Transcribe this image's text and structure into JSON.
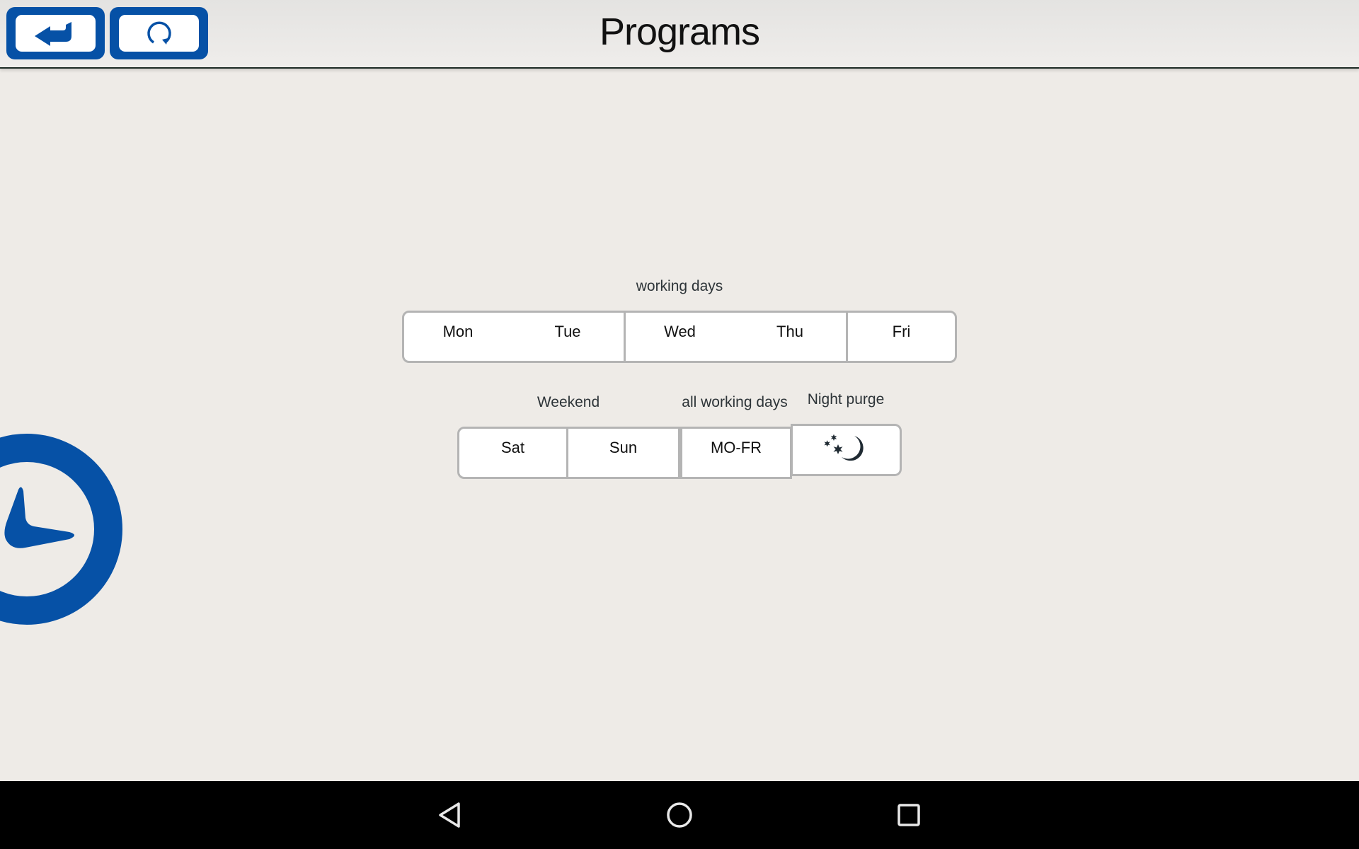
{
  "header": {
    "title": "Programs",
    "back_button": {
      "icon": "return-arrow-icon"
    },
    "refresh_button": {
      "icon": "refresh-icon"
    }
  },
  "groups": {
    "working_days": {
      "label": "working days",
      "days": [
        "Mon",
        "Tue",
        "Wed",
        "Thu",
        "Fri"
      ]
    },
    "weekend": {
      "label": "Weekend",
      "days": [
        "Sat",
        "Sun"
      ]
    },
    "all_working_days": {
      "label": "all working days",
      "button": "MO-FR"
    },
    "night_purge": {
      "label": "Night purge",
      "icon": "moon-stars-icon"
    }
  },
  "side_icon": "clock-icon",
  "navigation_bar": {
    "buttons": [
      "back",
      "home",
      "recents"
    ]
  },
  "colors": {
    "accent": "#0651a6",
    "background": "#eeebe7",
    "button_border": "#b4b4b4",
    "label_text": "#2d3438"
  }
}
